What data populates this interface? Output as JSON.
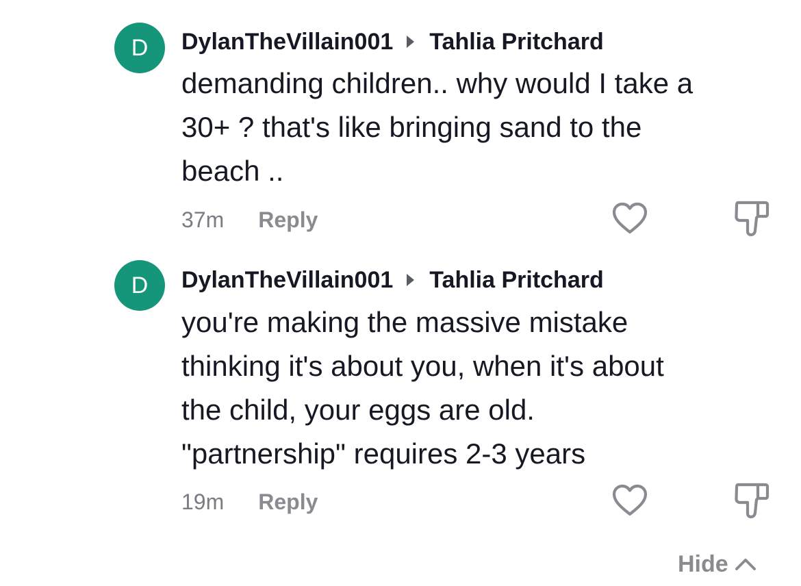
{
  "comments": [
    {
      "avatar_letter": "D",
      "author": "DylanTheVillain001",
      "reply_to": "Tahlia Pritchard",
      "text": "demanding children.. why would I take a\n30+ ? that's like bringing sand to the\nbeach ..",
      "time": "37m",
      "reply_label": "Reply",
      "like_icon": "heart-outline-icon",
      "dislike_icon": "thumbs-down-outline-icon"
    },
    {
      "avatar_letter": "D",
      "author": "DylanTheVillain001",
      "reply_to": "Tahlia Pritchard",
      "text": "you're making the massive mistake\nthinking it's about you, when it's about\nthe child, your eggs are old.\n\"partnership\" requires 2-3 years",
      "time": "19m",
      "reply_label": "Reply",
      "like_icon": "heart-outline-icon",
      "dislike_icon": "thumbs-down-outline-icon"
    }
  ],
  "hide_label": "Hide",
  "colors": {
    "avatar_bg": "#15967a",
    "primary_text": "#161823",
    "secondary_text": "#8a8b91"
  }
}
